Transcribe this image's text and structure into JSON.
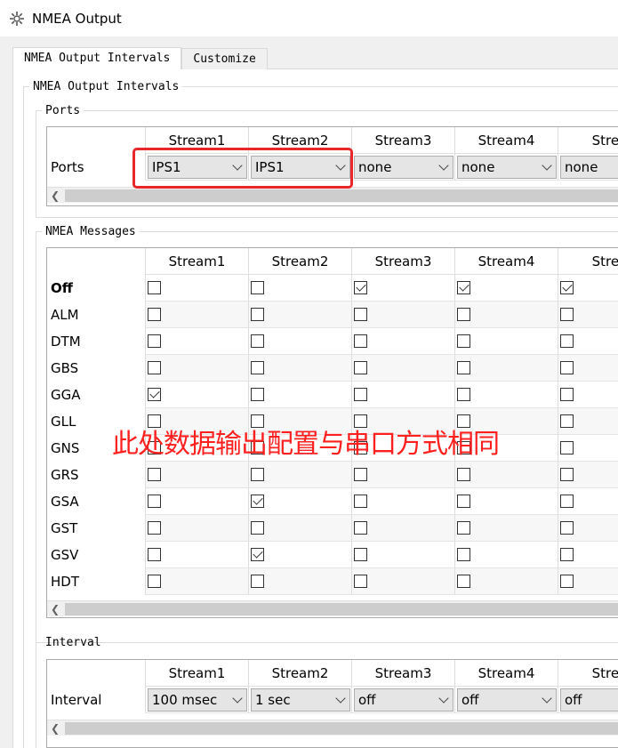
{
  "window": {
    "title": "NMEA Output",
    "icon": "gear-icon"
  },
  "tabs": [
    {
      "label": "NMEA Output Intervals",
      "active": true
    },
    {
      "label": "Customize",
      "active": false
    }
  ],
  "outer_group": {
    "legend": "NMEA Output Intervals"
  },
  "ports": {
    "legend": "Ports",
    "headers": [
      "Stream1",
      "Stream2",
      "Stream3",
      "Stream4",
      "Strea"
    ],
    "row_label": "Ports",
    "values": [
      "IPS1",
      "IPS1",
      "none",
      "none",
      "none"
    ]
  },
  "messages": {
    "legend": "NMEA Messages",
    "headers": [
      "Stream1",
      "Stream2",
      "Stream3",
      "Stream4",
      "Strea"
    ],
    "rows": [
      {
        "label": "Off",
        "bold": true,
        "checks": [
          false,
          false,
          true,
          true,
          true
        ]
      },
      {
        "label": "ALM",
        "checks": [
          false,
          false,
          false,
          false,
          false
        ]
      },
      {
        "label": "DTM",
        "checks": [
          false,
          false,
          false,
          false,
          false
        ]
      },
      {
        "label": "GBS",
        "checks": [
          false,
          false,
          false,
          false,
          false
        ]
      },
      {
        "label": "GGA",
        "checks": [
          true,
          false,
          false,
          false,
          false
        ]
      },
      {
        "label": "GLL",
        "checks": [
          false,
          false,
          false,
          false,
          false
        ]
      },
      {
        "label": "GNS",
        "checks": [
          false,
          false,
          false,
          false,
          false
        ]
      },
      {
        "label": "GRS",
        "checks": [
          false,
          false,
          false,
          false,
          false
        ]
      },
      {
        "label": "GSA",
        "checks": [
          false,
          true,
          false,
          false,
          false
        ]
      },
      {
        "label": "GST",
        "checks": [
          false,
          false,
          false,
          false,
          false
        ]
      },
      {
        "label": "GSV",
        "checks": [
          false,
          true,
          false,
          false,
          false
        ]
      },
      {
        "label": "HDT",
        "checks": [
          false,
          false,
          false,
          false,
          false
        ]
      }
    ]
  },
  "interval": {
    "legend": "Interval",
    "headers": [
      "Stream1",
      "Stream2",
      "Stream3",
      "Stream4",
      "Strea"
    ],
    "row_label": "Interval",
    "values": [
      "100 msec",
      "1 sec",
      "off",
      "off",
      "off"
    ]
  },
  "annotation": {
    "text": "此处数据输出配置与串口方式相同",
    "color": "#ff2020"
  },
  "colors": {
    "highlight": "#e8262b",
    "annotation": "#ff2020"
  }
}
